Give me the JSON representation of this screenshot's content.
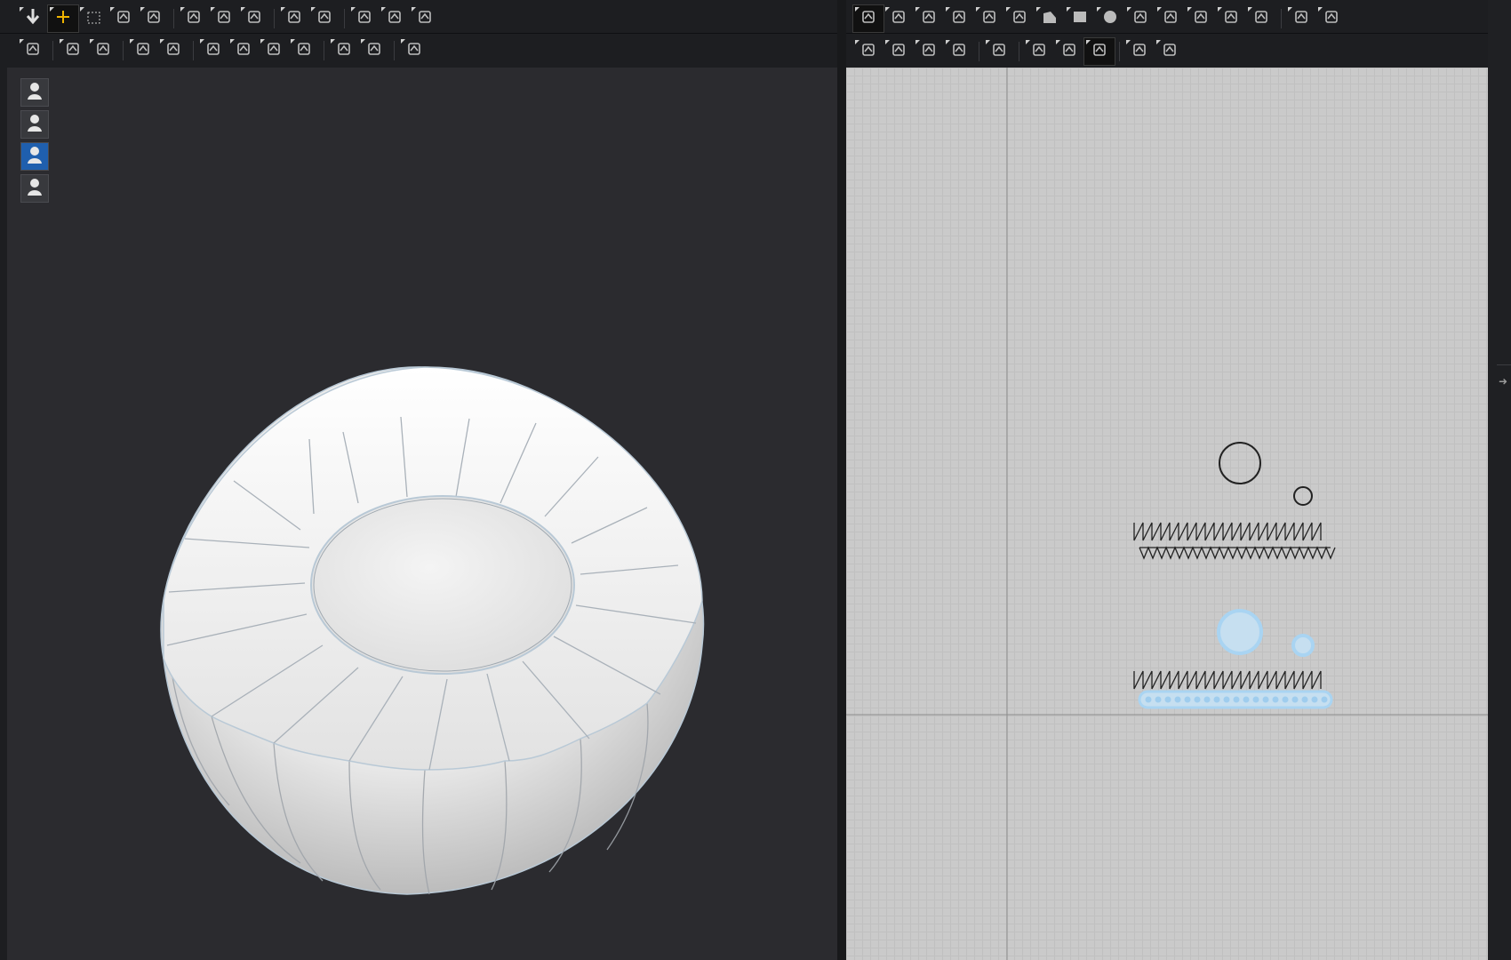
{
  "toolbar_3d": {
    "row1": [
      {
        "icon": "move-down-arrow-icon",
        "active": false
      },
      {
        "icon": "select-move-icon",
        "active": true
      },
      {
        "icon": "box-select-icon",
        "active": false
      },
      {
        "icon": "transform-pattern-icon",
        "active": false
      },
      {
        "icon": "fold-arrangement-icon",
        "active": false
      },
      {
        "sep": true
      },
      {
        "icon": "edit-sewing-icon",
        "active": false
      },
      {
        "icon": "tack-icon",
        "active": false
      },
      {
        "icon": "garment-fit-icon",
        "active": false
      },
      {
        "sep": true
      },
      {
        "icon": "arrangement-point-icon",
        "active": false
      },
      {
        "icon": "arrangement-shape-icon",
        "active": false
      },
      {
        "sep": true
      },
      {
        "icon": "pin-icon",
        "active": false
      },
      {
        "icon": "lasso-icon",
        "active": false
      },
      {
        "icon": "ruler-icon",
        "active": false
      }
    ],
    "row2": [
      {
        "icon": "avatar-pose-icon",
        "active": false
      },
      {
        "sep": true
      },
      {
        "icon": "strengthen-icon",
        "active": false
      },
      {
        "icon": "edit-brush-icon",
        "active": false
      },
      {
        "sep": true
      },
      {
        "icon": "texture-icon",
        "active": false
      },
      {
        "icon": "graphic-icon",
        "active": false
      },
      {
        "sep": true
      },
      {
        "icon": "button-icon",
        "active": false
      },
      {
        "icon": "button-plain-icon",
        "active": false
      },
      {
        "icon": "zipper-icon",
        "active": false
      },
      {
        "icon": "buttonhole-icon",
        "active": false
      },
      {
        "sep": true
      },
      {
        "icon": "tape-icon",
        "active": false
      },
      {
        "icon": "fabric-layer-icon",
        "active": false
      },
      {
        "sep": true
      },
      {
        "icon": "measure-distance-icon",
        "active": false
      }
    ]
  },
  "toolbar_2d": {
    "row1": [
      {
        "icon": "transform-pattern-icon",
        "active": true
      },
      {
        "icon": "edit-point-icon",
        "active": false
      },
      {
        "icon": "edit-curvature-icon",
        "active": false
      },
      {
        "icon": "curve-point-icon",
        "active": false
      },
      {
        "icon": "add-point-icon",
        "active": false
      },
      {
        "icon": "split-line-icon",
        "active": false
      },
      {
        "icon": "polygon-icon",
        "active": false
      },
      {
        "icon": "rectangle-icon",
        "active": false
      },
      {
        "icon": "circle-icon",
        "active": false
      },
      {
        "icon": "internal-polygon-icon",
        "active": false
      },
      {
        "icon": "internal-rectangle-icon",
        "active": false
      },
      {
        "icon": "internal-circle-icon",
        "active": false
      },
      {
        "icon": "dart-icon",
        "active": false
      },
      {
        "icon": "trace-icon",
        "active": false
      },
      {
        "sep": true
      },
      {
        "icon": "pleat-icon",
        "active": false
      },
      {
        "icon": "fold-icon",
        "active": false
      }
    ],
    "row2": [
      {
        "icon": "segment-sewing-icon",
        "active": false
      },
      {
        "icon": "free-sewing-icon",
        "active": false
      },
      {
        "icon": "sewing-m-to-n-icon",
        "active": false
      },
      {
        "icon": "edit-sewing-2d-icon",
        "active": false
      },
      {
        "sep": true
      },
      {
        "icon": "iron-icon",
        "active": false
      },
      {
        "sep": true
      },
      {
        "icon": "texture-2d-icon",
        "active": false
      },
      {
        "icon": "graphic-2d-icon",
        "active": false
      },
      {
        "icon": "trim-icon",
        "active": true
      },
      {
        "sep": true
      },
      {
        "icon": "grid-select-icon",
        "active": false
      },
      {
        "icon": "grid-snap-icon",
        "active": false
      }
    ]
  },
  "side_tools_3d": [
    {
      "icon": "show-garment-icon",
      "active": false
    },
    {
      "icon": "show-avatar-icon",
      "active": false
    },
    {
      "icon": "fabric-texture-icon",
      "active": true
    },
    {
      "icon": "avatar-silhouette-icon",
      "active": false
    }
  ],
  "colors": {
    "background": "#1d1e21",
    "viewport_3d": "#2b2b2f",
    "viewport_2d": "#cacaca",
    "grid_line": "#c0c0c0",
    "accent_active": "#f0b400",
    "pattern_outline": "#222222",
    "pattern_selected": "#a9d4f2"
  }
}
